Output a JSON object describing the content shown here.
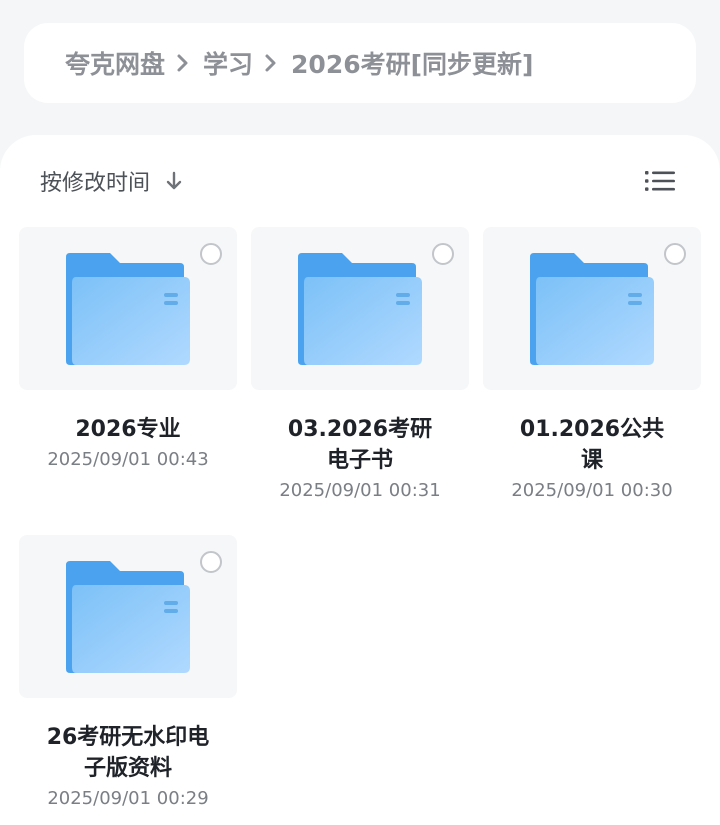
{
  "breadcrumb": {
    "items": [
      "夸克网盘",
      "学习",
      "2026考研[同步更新]"
    ]
  },
  "toolbar": {
    "sort_label": "按修改时间",
    "sort_direction_icon": "arrow-down-icon",
    "view_icon": "list-view-icon"
  },
  "files": [
    {
      "name": "2026专业",
      "date": "2025/09/01 00:43",
      "type": "folder"
    },
    {
      "name": "03.2026考研电子书",
      "date": "2025/09/01 00:31",
      "type": "folder"
    },
    {
      "name": "01.2026公共课",
      "date": "2025/09/01 00:30",
      "type": "folder"
    },
    {
      "name": "26考研无水印电子版资料",
      "date": "2025/09/01 00:29",
      "type": "folder"
    }
  ],
  "colors": {
    "folder_back": "#4ba3ef",
    "folder_front_start": "#7cc1f7",
    "folder_front_end": "#b0d9ff",
    "text_muted": "#8d9096"
  }
}
